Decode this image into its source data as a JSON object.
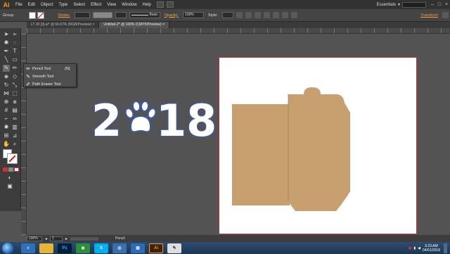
{
  "menubar": {
    "logo": "Ai",
    "items": [
      "File",
      "Edit",
      "Object",
      "Type",
      "Select",
      "Effect",
      "View",
      "Window",
      "Help"
    ],
    "workspace": "Essentials"
  },
  "controlbar": {
    "group_label": "Group",
    "stroke_label": "Stroke:",
    "brush_label": "Basic",
    "opacity_label": "Opacity:",
    "opacity_value": "100%",
    "style_label": "Style:",
    "transform_label": "Transform"
  },
  "tabs": [
    {
      "label": "LT 30 [3].ai* @ 66.67% (RGB/Preview)"
    },
    {
      "label": "Untitled-2* @ 100% (CMYK/Preview)"
    }
  ],
  "flyout": {
    "items": [
      {
        "label": "Pencil Tool",
        "shortcut": "(N)",
        "icon": "pencil-icon"
      },
      {
        "label": "Smooth Tool",
        "shortcut": "",
        "icon": "smooth-icon"
      },
      {
        "label": "Path Eraser Tool",
        "shortcut": "",
        "icon": "path-eraser-icon"
      }
    ]
  },
  "artwork": {
    "year_left": "2",
    "year_right": "18",
    "text_color": "#ffffff",
    "outline_color": "#3d5aa6",
    "envelope_color": "#c89f6e"
  },
  "statusbar": {
    "zoom": "100%",
    "page": "1",
    "tool": "Pencil"
  },
  "taskbar": {
    "time": "9:23 AM",
    "date": "04/01/2018"
  }
}
